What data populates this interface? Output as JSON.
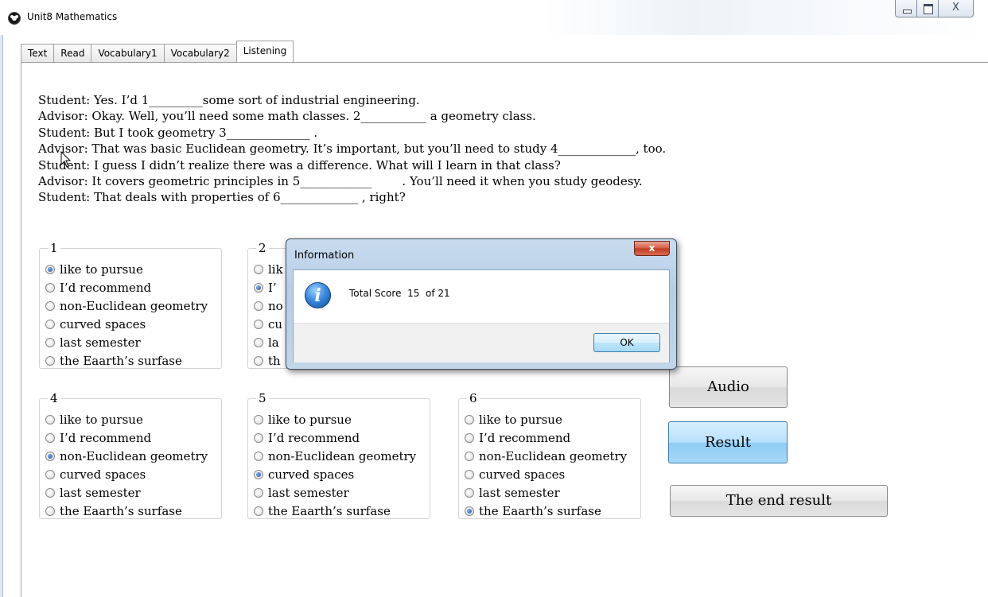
{
  "window": {
    "title": "Unit8 Mathematics",
    "close_glyph": "X"
  },
  "tabs": [
    "Text",
    "Read",
    "Vocabulary1",
    "Vocabulary2",
    "Listening"
  ],
  "active_tab": "Listening",
  "passage": [
    "Student: Yes. I’d 1_________some sort of industrial engineering.",
    "Advisor: Okay. Well, you’ll need some math classes. 2___________ a geometry class.",
    "Student: But I took geometry 3______________ .",
    "Advisor: That was basic Euclidean geometry. It’s important, but you’ll need to study 4_____________, too.",
    "Student: I guess I didn’t realize there was a difference. What will I learn in that class?",
    "Advisor: It covers geometric principles in 5____________        . You’ll need it when you study geodesy.",
    "Student: That deals with properties of 6_____________ , right?"
  ],
  "groups": [
    {
      "label": "1",
      "selected": 0,
      "options": [
        "like to pursue",
        "I’d recommend",
        "non-Euclidean geometry",
        "curved spaces",
        "last semester",
        "the Eaarth’s surfase"
      ]
    },
    {
      "label": "2",
      "selected": 1,
      "options": [
        "lik",
        "I’",
        "no",
        "cu",
        "la",
        "th"
      ]
    },
    {
      "label": "4",
      "selected": 2,
      "options": [
        "like to pursue",
        "I’d recommend",
        "non-Euclidean geometry",
        "curved spaces",
        "last semester",
        "the Eaarth’s surfase"
      ]
    },
    {
      "label": "5",
      "selected": 3,
      "options": [
        "like to pursue",
        "I’d recommend",
        "non-Euclidean geometry",
        "curved spaces",
        "last semester",
        "the Eaarth’s surfase"
      ]
    },
    {
      "label": "6",
      "selected": 5,
      "options": [
        "like to pursue",
        "I’d recommend",
        "non-Euclidean geometry",
        "curved spaces",
        "last semester",
        "the Eaarth’s surfase"
      ]
    }
  ],
  "buttons": {
    "audio": "Audio",
    "result": "Result",
    "end_result": "The end result"
  },
  "dialog": {
    "title": "Information",
    "close_glyph": "x",
    "message": "Total Score  15  of 21",
    "ok": "OK"
  }
}
